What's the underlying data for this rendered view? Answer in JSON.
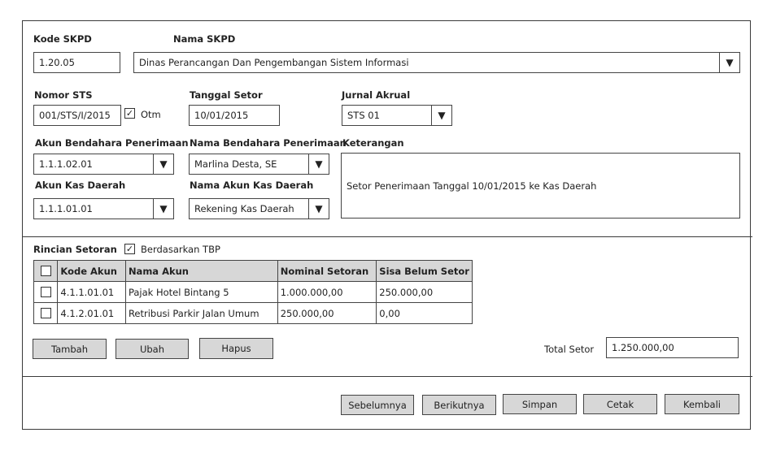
{
  "skpd": {
    "kode_label": "Kode SKPD",
    "kode_value": "1.20.05",
    "nama_label": "Nama SKPD",
    "nama_value": "Dinas Perancangan Dan Pengembangan Sistem Informasi"
  },
  "sts": {
    "nomor_label": "Nomor STS",
    "nomor_value": "001/STS/I/2015",
    "otm_label": "Otm",
    "otm_checked": true,
    "tanggal_label": "Tanggal Setor",
    "tanggal_value": "10/01/2015",
    "jurnal_label": "Jurnal Akrual",
    "jurnal_value": "STS 01"
  },
  "bendahara": {
    "akun_label": "Akun Bendahara Penerimaan",
    "akun_value": "1.1.1.02.01",
    "nama_label": "Nama Bendahara Penerimaan",
    "nama_value": "Marlina Desta, SE"
  },
  "kas": {
    "akun_label": "Akun Kas Daerah",
    "akun_value": "1.1.1.01.01",
    "nama_label": "Nama Akun Kas Daerah",
    "nama_value": "Rekening Kas Daerah"
  },
  "keterangan": {
    "label": "Keterangan",
    "value": "Setor Penerimaan Tanggal 10/01/2015 ke Kas Daerah"
  },
  "rincian": {
    "label": "Rincian Setoran",
    "tbp_label": "Berdasarkan TBP",
    "tbp_checked": true,
    "columns": [
      "Kode Akun",
      "Nama Akun",
      "Nominal Setoran",
      "Sisa Belum Setor"
    ],
    "rows": [
      {
        "kode": "4.1.1.01.01",
        "nama": "Pajak Hotel Bintang 5",
        "nominal": "1.000.000,00",
        "sisa": "250.000,00"
      },
      {
        "kode": "4.1.2.01.01",
        "nama": "Retribusi Parkir Jalan Umum",
        "nominal": "250.000,00",
        "sisa": "0,00"
      }
    ],
    "buttons": {
      "tambah": "Tambah",
      "ubah": "Ubah",
      "hapus": "Hapus"
    },
    "total_label": "Total Setor",
    "total_value": "1.250.000,00"
  },
  "footer": {
    "sebelumnya": "Sebelumnya",
    "berikutnya": "Berikutnya",
    "simpan": "Simpan",
    "cetak": "Cetak",
    "kembali": "Kembali"
  },
  "icons": {
    "dropdown": "chevron-down-icon",
    "check": "checkmark-icon"
  }
}
